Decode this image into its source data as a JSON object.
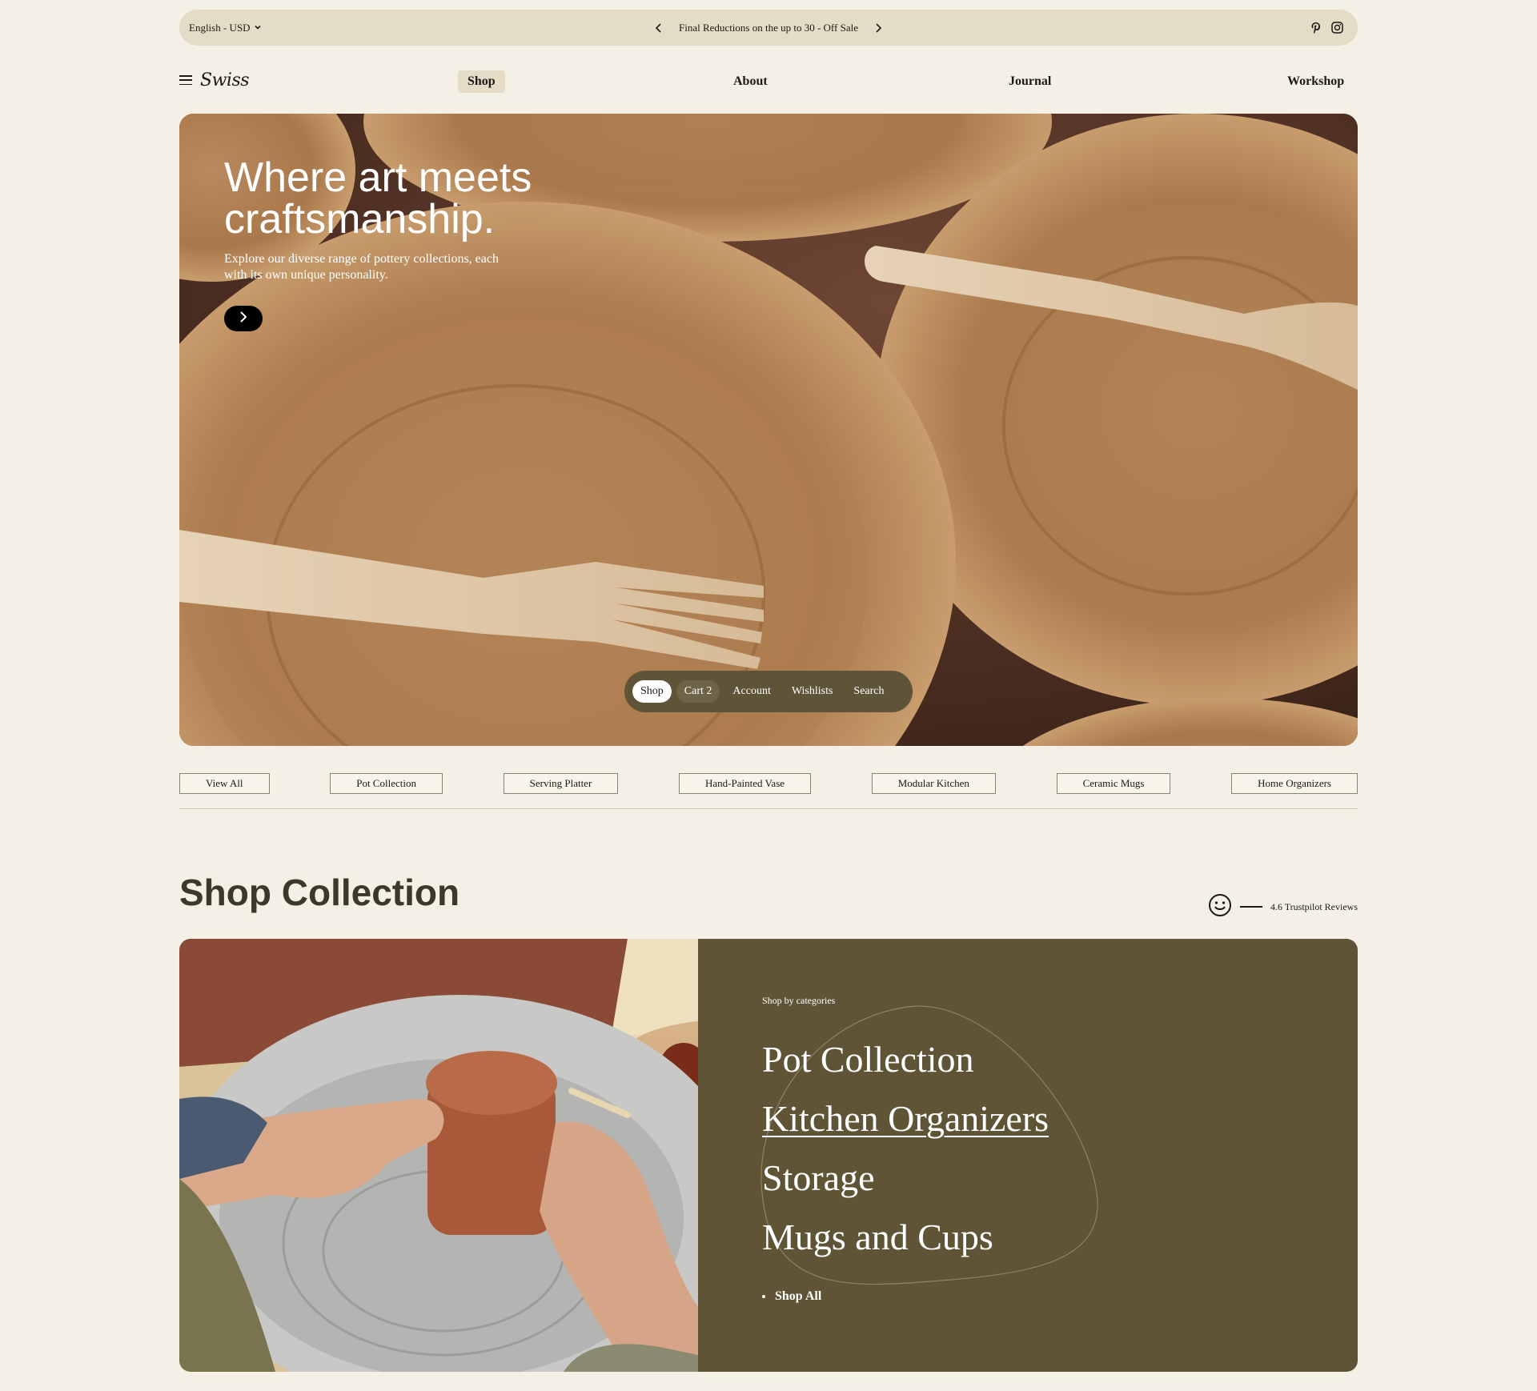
{
  "announcement": {
    "language": "English - USD",
    "promo": "Final Reductions on the up to 30 - Off Sale",
    "socials": [
      "pinterest-icon",
      "instagram-icon"
    ]
  },
  "header": {
    "logo": "Swiss",
    "nav": [
      {
        "label": "Shop",
        "active": true
      },
      {
        "label": "About"
      },
      {
        "label": "Journal"
      },
      {
        "label": "Workshop"
      }
    ]
  },
  "hero": {
    "title": "Where art meets craftsmanship.",
    "subtitle": "Explore our diverse range of pottery collections, each with its own unique personality.",
    "dock": [
      "Shop",
      "Cart 2",
      "Account",
      "Wishlists",
      "Search"
    ]
  },
  "categories": [
    "View All",
    "Pot Collection",
    "Serving Platter",
    "Hand-Painted Vase",
    "Modular Kitchen",
    "Ceramic Mugs",
    "Home Organizers"
  ],
  "shop_collection": {
    "title": "Shop Collection",
    "trustpilot": "4.6 Trustpilot Reviews",
    "kicker": "Shop by categories",
    "items": [
      "Pot Collection",
      "Kitchen Organizers",
      "Storage",
      "Mugs and Cups"
    ],
    "shop_all": "Shop All"
  },
  "colors": {
    "background": "#f5f0e6",
    "announce_bar": "#e4dcc6",
    "panel": "#5f5536",
    "dock": "#5e5437"
  }
}
